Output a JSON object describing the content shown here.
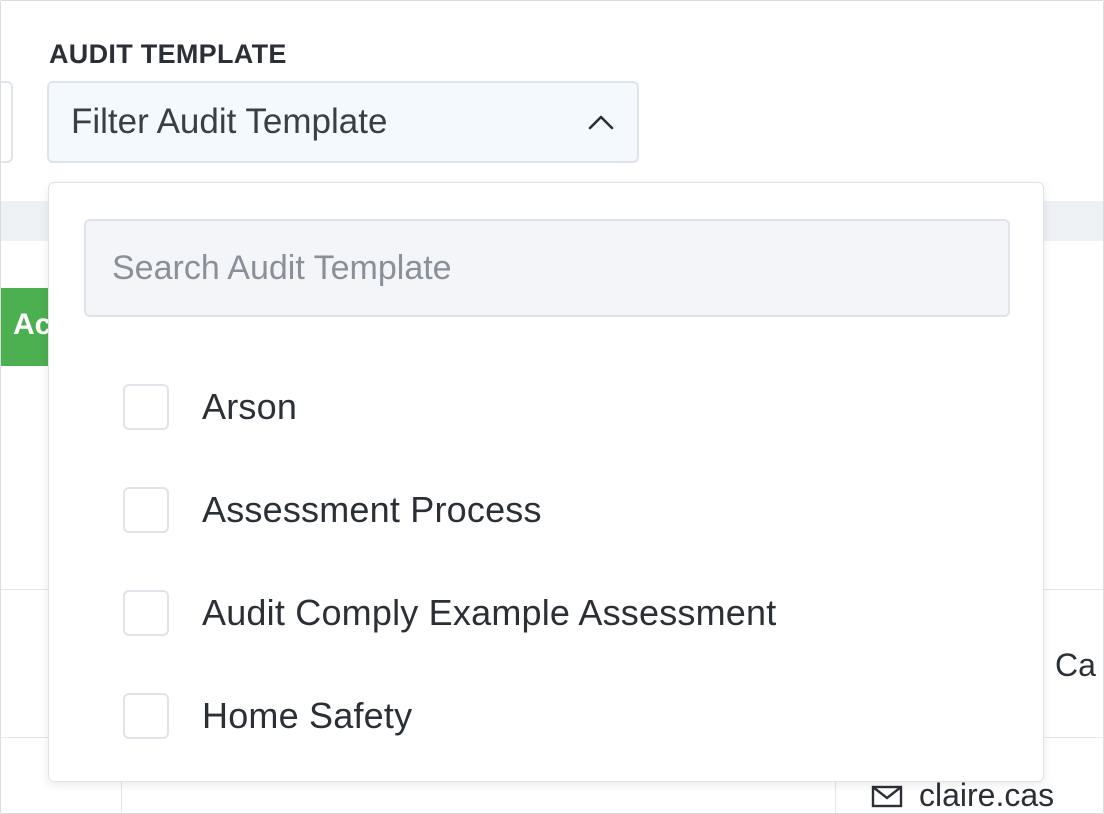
{
  "background": {
    "green_button_text": "Ac",
    "partial_name": "Ca",
    "partial_email": "claire.cas"
  },
  "filter": {
    "label": "AUDIT TEMPLATE",
    "placeholder": "Filter Audit Template",
    "state_icon": "chevron-up-icon"
  },
  "dropdown": {
    "search_placeholder": "Search Audit Template",
    "options": [
      {
        "label": "Arson",
        "checked": false
      },
      {
        "label": "Assessment Process",
        "checked": false
      },
      {
        "label": "Audit Comply Example Assessment",
        "checked": false
      },
      {
        "label": "Home Safety",
        "checked": false
      }
    ]
  },
  "colors": {
    "accent_green": "#4caf50",
    "border": "#dfe4ea",
    "select_bg": "#f4f9fd",
    "text": "#2b2f36"
  }
}
